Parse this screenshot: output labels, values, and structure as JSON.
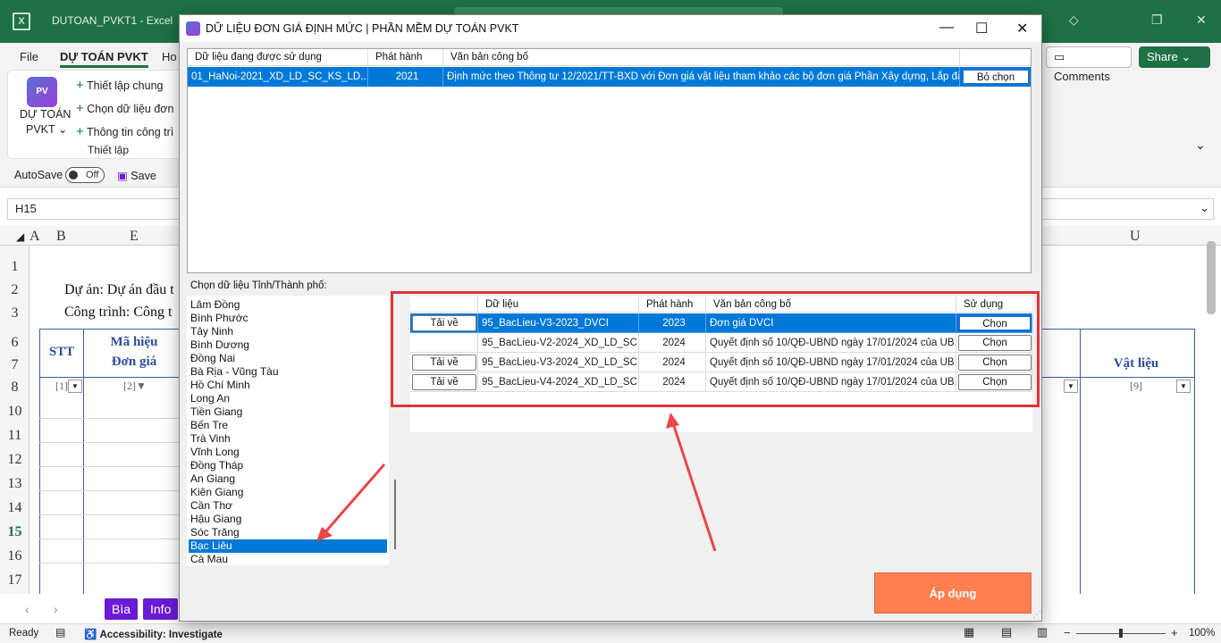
{
  "excel": {
    "filename": "DUTOAN_PVKT1",
    "app": "Excel",
    "menu": [
      "File",
      "DỰ TOÁN PVKT",
      "Ho"
    ],
    "ribbon": {
      "addin_label_1": "DỰ TOÁN",
      "addin_label_2": "PVKT",
      "items": [
        "Thiết lập chung",
        "Chọn dữ liệu đơn",
        "Thông tin công trì"
      ],
      "group_label": "Thiết lập"
    },
    "comments_label": "Comments",
    "share_label": "Share",
    "autosave_label": "AutoSave",
    "autosave_state": "Off",
    "save_label": "Save",
    "name_box": "H15",
    "col_labels": {
      "a": "A",
      "b": "B",
      "e": "E",
      "u": "U"
    },
    "row_numbers": [
      "1",
      "2",
      "3",
      "6",
      "7",
      "8",
      "10",
      "11",
      "12",
      "13",
      "14",
      "15",
      "16",
      "17"
    ],
    "sheet_text": {
      "du_an": "Dự án: Dự án đầu t",
      "cong_trinh": "Công trình: Công t",
      "stt": "STT",
      "ma_hieu_1": "Mã hiệu",
      "ma_hieu_2": "Đơn giá",
      "vat_lieu": "Vật liệu",
      "f1": "[1]",
      "f2": "[2]▼",
      "f9": "[9]"
    },
    "sheet_tabs": [
      "Bìa",
      "Info"
    ],
    "status": {
      "ready": "Ready",
      "accessibility": "Accessibility: Investigate",
      "zoom": "100%"
    }
  },
  "dialog": {
    "title": "DỮ LIỆU ĐƠN GIÁ ĐỊNH MỨC | PHẦN MỀM DỰ TOÁN PVKT",
    "top_grid": {
      "headers": [
        "Dữ liệu đang được sử dụng",
        "Phát hành",
        "Văn bản công bố"
      ],
      "row": {
        "data": "01_HaNoi-2021_XD_LD_SC_KS_LD...",
        "year": "2021",
        "doc": "Định mức theo Thông tư 12/2021/TT-BXD với Đơn giá vật liệu tham khảo các bộ đơn giá Phần Xây dựng, Lắp đặt, K...",
        "button": "Bỏ chọn"
      }
    },
    "province_label": "Chọn dữ liệu Tỉnh/Thành phố:",
    "provinces": [
      "Lâm Đồng",
      "Bình Phước",
      "Tây Ninh",
      "Bình Dương",
      "Đồng Nai",
      "Bà Rịa - Vũng Tàu",
      "Hồ Chí Minh",
      "Long An",
      "Tiền Giang",
      "Bến Tre",
      "Trà Vinh",
      "Vĩnh Long",
      "Đồng Tháp",
      "An Giang",
      "Kiên Giang",
      "Cần Thơ",
      "Hậu Giang",
      "Sóc Trăng",
      "Bạc Liêu",
      "Cà Mau"
    ],
    "selected_province": "Bạc Liêu",
    "bottom_grid": {
      "headers": [
        "Dữ liệu",
        "Phát hành",
        "Văn bản công bố",
        "Sử dụng"
      ],
      "rows": [
        {
          "download": "Tải về",
          "data": "95_BacLieu-V3-2023_DVCI",
          "year": "2023",
          "doc": "Đơn giá DVCI",
          "use": "Chọn"
        },
        {
          "download": "",
          "data": "95_BacLieu-V2-2024_XD_LD_SC...",
          "year": "2024",
          "doc": "Quyết định số 10/QĐ-UBND ngày 17/01/2024 của UB...",
          "use": "Chọn"
        },
        {
          "download": "Tải về",
          "data": "95_BacLieu-V3-2024_XD_LD_SC...",
          "year": "2024",
          "doc": "Quyết định số 10/QĐ-UBND ngày 17/01/2024 của UB...",
          "use": "Chọn"
        },
        {
          "download": "Tải về",
          "data": "95_BacLieu-V4-2024_XD_LD_SC...",
          "year": "2024",
          "doc": "Quyết định số 10/QĐ-UBND ngày 17/01/2024 của UB...",
          "use": "Chọn"
        }
      ]
    },
    "apply_label": "Áp dụng"
  },
  "colors": {
    "excel_green": "#1e7145",
    "selection_blue": "#0078d7",
    "apply_orange": "#ff7f50",
    "highlight_red": "#e0343a"
  }
}
